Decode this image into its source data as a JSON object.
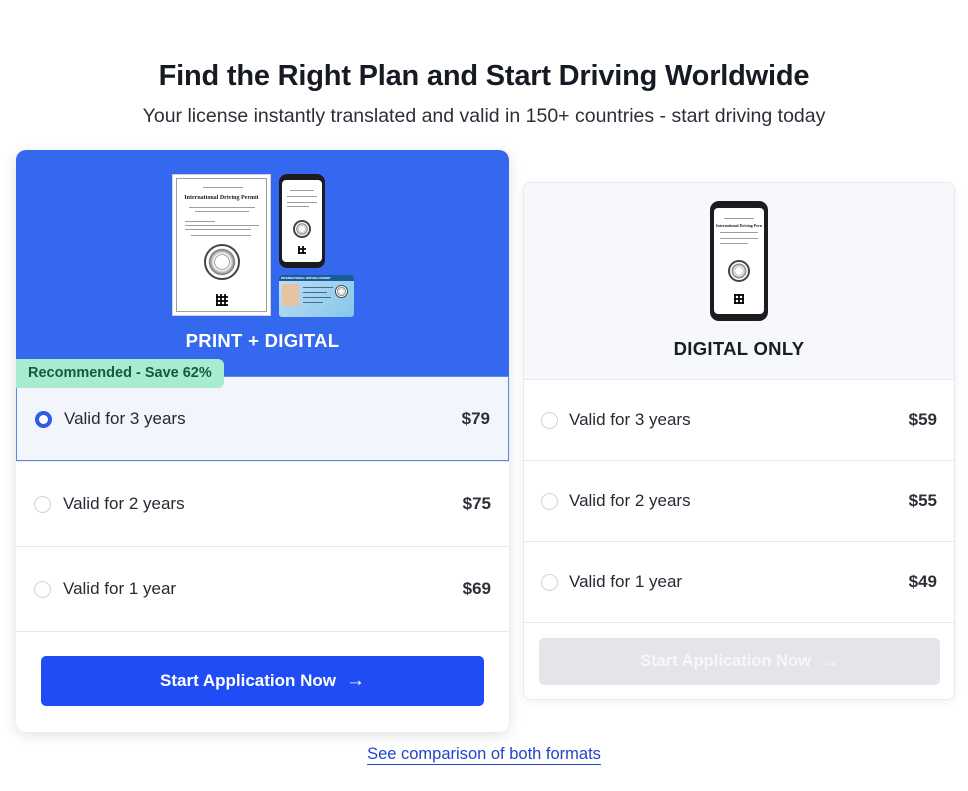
{
  "header": {
    "title": "Find the Right Plan and Start Driving Worldwide",
    "subtitle": "Your license instantly translated and valid in 150+ countries - start driving today"
  },
  "print_digital": {
    "title": "PRINT + DIGITAL",
    "badge": "Recommended - Save 62%",
    "doc_title": "International Driving Permit",
    "id_card_title": "INTERNATIONAL DRIVING PERMIT",
    "options": [
      {
        "label": "Valid for 3 years",
        "price": "$79",
        "selected": true
      },
      {
        "label": "Valid for 2 years",
        "price": "$75",
        "selected": false
      },
      {
        "label": "Valid for 1 year",
        "price": "$69",
        "selected": false
      }
    ],
    "cta": "Start Application Now",
    "cta_icon": "arrow-right-icon"
  },
  "digital_only": {
    "title": "DIGITAL ONLY",
    "doc_title": "International Driving Permit",
    "options": [
      {
        "label": "Valid for 3 years",
        "price": "$59",
        "selected": false
      },
      {
        "label": "Valid for 2 years",
        "price": "$55",
        "selected": false
      },
      {
        "label": "Valid for 1 year",
        "price": "$49",
        "selected": false
      }
    ],
    "cta": "Start Application Now",
    "cta_icon": "arrow-right-icon"
  },
  "compare_link": "See comparison of both formats",
  "colors": {
    "primary": "#1f4cf5",
    "banner": "#3468ef",
    "badge_bg": "#a8ecd0",
    "badge_text": "#115b3e",
    "link": "#2244c8"
  }
}
